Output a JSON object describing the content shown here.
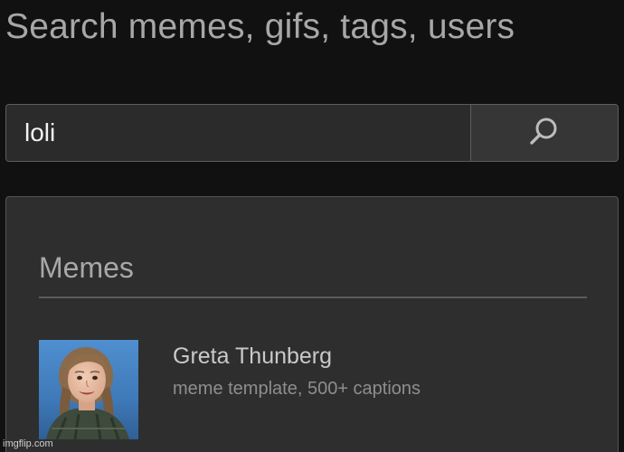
{
  "page": {
    "title": "Search memes, gifs, tags, users"
  },
  "search": {
    "value": "loli",
    "button_icon": "search-icon"
  },
  "results": {
    "section_heading": "Memes",
    "items": [
      {
        "name": "Greta Thunberg",
        "meta": "meme template, 500+ captions",
        "thumbnail": "portrait-photo"
      }
    ]
  },
  "watermark": "imgflip.com",
  "colors": {
    "background": "#111112",
    "panel": "#2e2e2f",
    "input": "#2b2b2c",
    "border": "#5e5e5e"
  }
}
